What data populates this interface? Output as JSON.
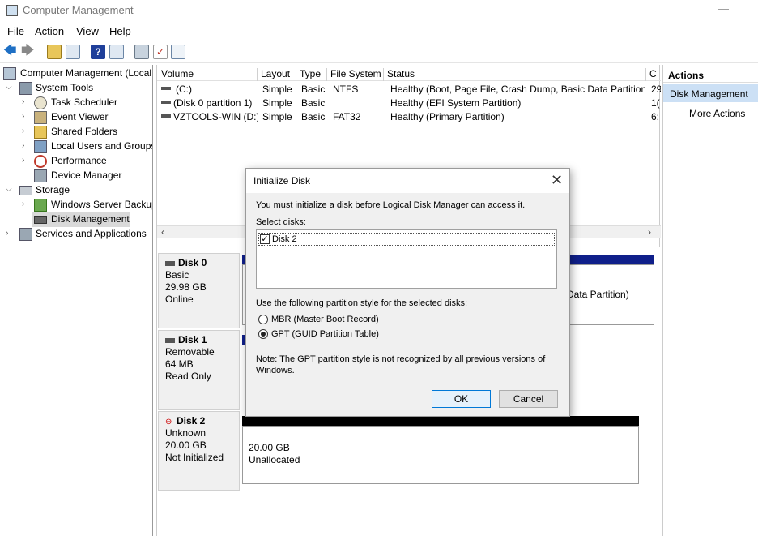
{
  "window": {
    "title": "Computer Management"
  },
  "menu": {
    "file": "File",
    "action": "Action",
    "view": "View",
    "help": "Help"
  },
  "tree": {
    "root": "Computer Management (Local",
    "system_tools": "System Tools",
    "task_scheduler": "Task Scheduler",
    "event_viewer": "Event Viewer",
    "shared_folders": "Shared Folders",
    "local_users": "Local Users and Groups",
    "performance": "Performance",
    "device_manager": "Device Manager",
    "storage": "Storage",
    "windows_server_backup": "Windows Server Backup",
    "disk_management": "Disk Management",
    "services_apps": "Services and Applications"
  },
  "columns": {
    "volume": "Volume",
    "layout": "Layout",
    "type": "Type",
    "fs": "File System",
    "status": "Status",
    "c": "C"
  },
  "volumes": [
    {
      "name": "(C:)",
      "layout": "Simple",
      "type": "Basic",
      "fs": "NTFS",
      "status": "Healthy (Boot, Page File, Crash Dump, Basic Data Partition)",
      "c": "29"
    },
    {
      "name": "(Disk 0 partition 1)",
      "layout": "Simple",
      "type": "Basic",
      "fs": "",
      "status": "Healthy (EFI System Partition)",
      "c": "1("
    },
    {
      "name": "VZTOOLS-WIN (D:)",
      "layout": "Simple",
      "type": "Basic",
      "fs": "FAT32",
      "status": "Healthy (Primary Partition)",
      "c": "6:"
    }
  ],
  "disks": {
    "disk0": {
      "name": "Disk 0",
      "kind": "Basic",
      "size": "29.98 GB",
      "state": "Online",
      "partition_tail": "Data Partition)"
    },
    "disk1": {
      "name": "Disk 1",
      "kind": "Removable",
      "size": "64 MB",
      "state": "Read Only"
    },
    "disk2": {
      "name": "Disk 2",
      "kind": "Unknown",
      "size": "20.00 GB",
      "state": "Not Initialized",
      "vol_size": "20.00 GB",
      "vol_state": "Unallocated"
    }
  },
  "actions": {
    "header": "Actions",
    "disk_management": "Disk Management",
    "more": "More Actions"
  },
  "dialog": {
    "title": "Initialize Disk",
    "intro": "You must initialize a disk before Logical Disk Manager can access it.",
    "select_label": "Select disks:",
    "disk_item": "Disk 2",
    "style_label": "Use the following partition style for the selected disks:",
    "mbr": "MBR (Master Boot Record)",
    "gpt": "GPT (GUID Partition Table)",
    "note_line1": "Note: The GPT partition style is not recognized by all previous versions of",
    "note_line2": "Windows.",
    "ok": "OK",
    "cancel": "Cancel",
    "selected_style": "GPT"
  }
}
